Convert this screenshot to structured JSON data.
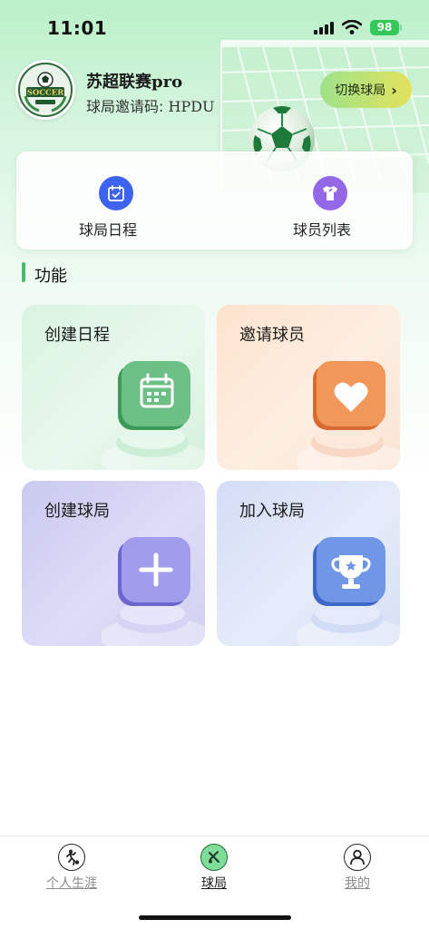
{
  "status_bar": {
    "time": "11:01",
    "battery": "98"
  },
  "header": {
    "logo_text": "SOCCER",
    "league_name": "苏超联赛pro",
    "invite_label": "球局邀请码: ",
    "invite_code": "HPDU",
    "switch_button": "切换球局",
    "switch_icon": "chevron-right-icon"
  },
  "quick_actions": [
    {
      "label": "球局日程",
      "icon": "calendar-check-icon",
      "color": "#3e63f0"
    },
    {
      "label": "球员列表",
      "icon": "jersey-icon",
      "color": "#9367e8"
    }
  ],
  "section": {
    "title": "功能",
    "accent": "#4bb96a"
  },
  "functions": [
    {
      "title": "创建日程",
      "icon": "calendar-icon",
      "color": "#5fb37a"
    },
    {
      "title": "邀请球员",
      "icon": "heart-icon",
      "color": "#f08a4b"
    },
    {
      "title": "创建球局",
      "icon": "plus-icon",
      "color": "#8b86e0"
    },
    {
      "title": "加入球局",
      "icon": "trophy-icon",
      "color": "#5b83de"
    }
  ],
  "tabs": [
    {
      "label": "个人生涯",
      "icon": "runner-icon",
      "active": false
    },
    {
      "label": "球局",
      "icon": "ball-tools-icon",
      "active": true
    },
    {
      "label": "我的",
      "icon": "person-icon",
      "active": false
    }
  ]
}
